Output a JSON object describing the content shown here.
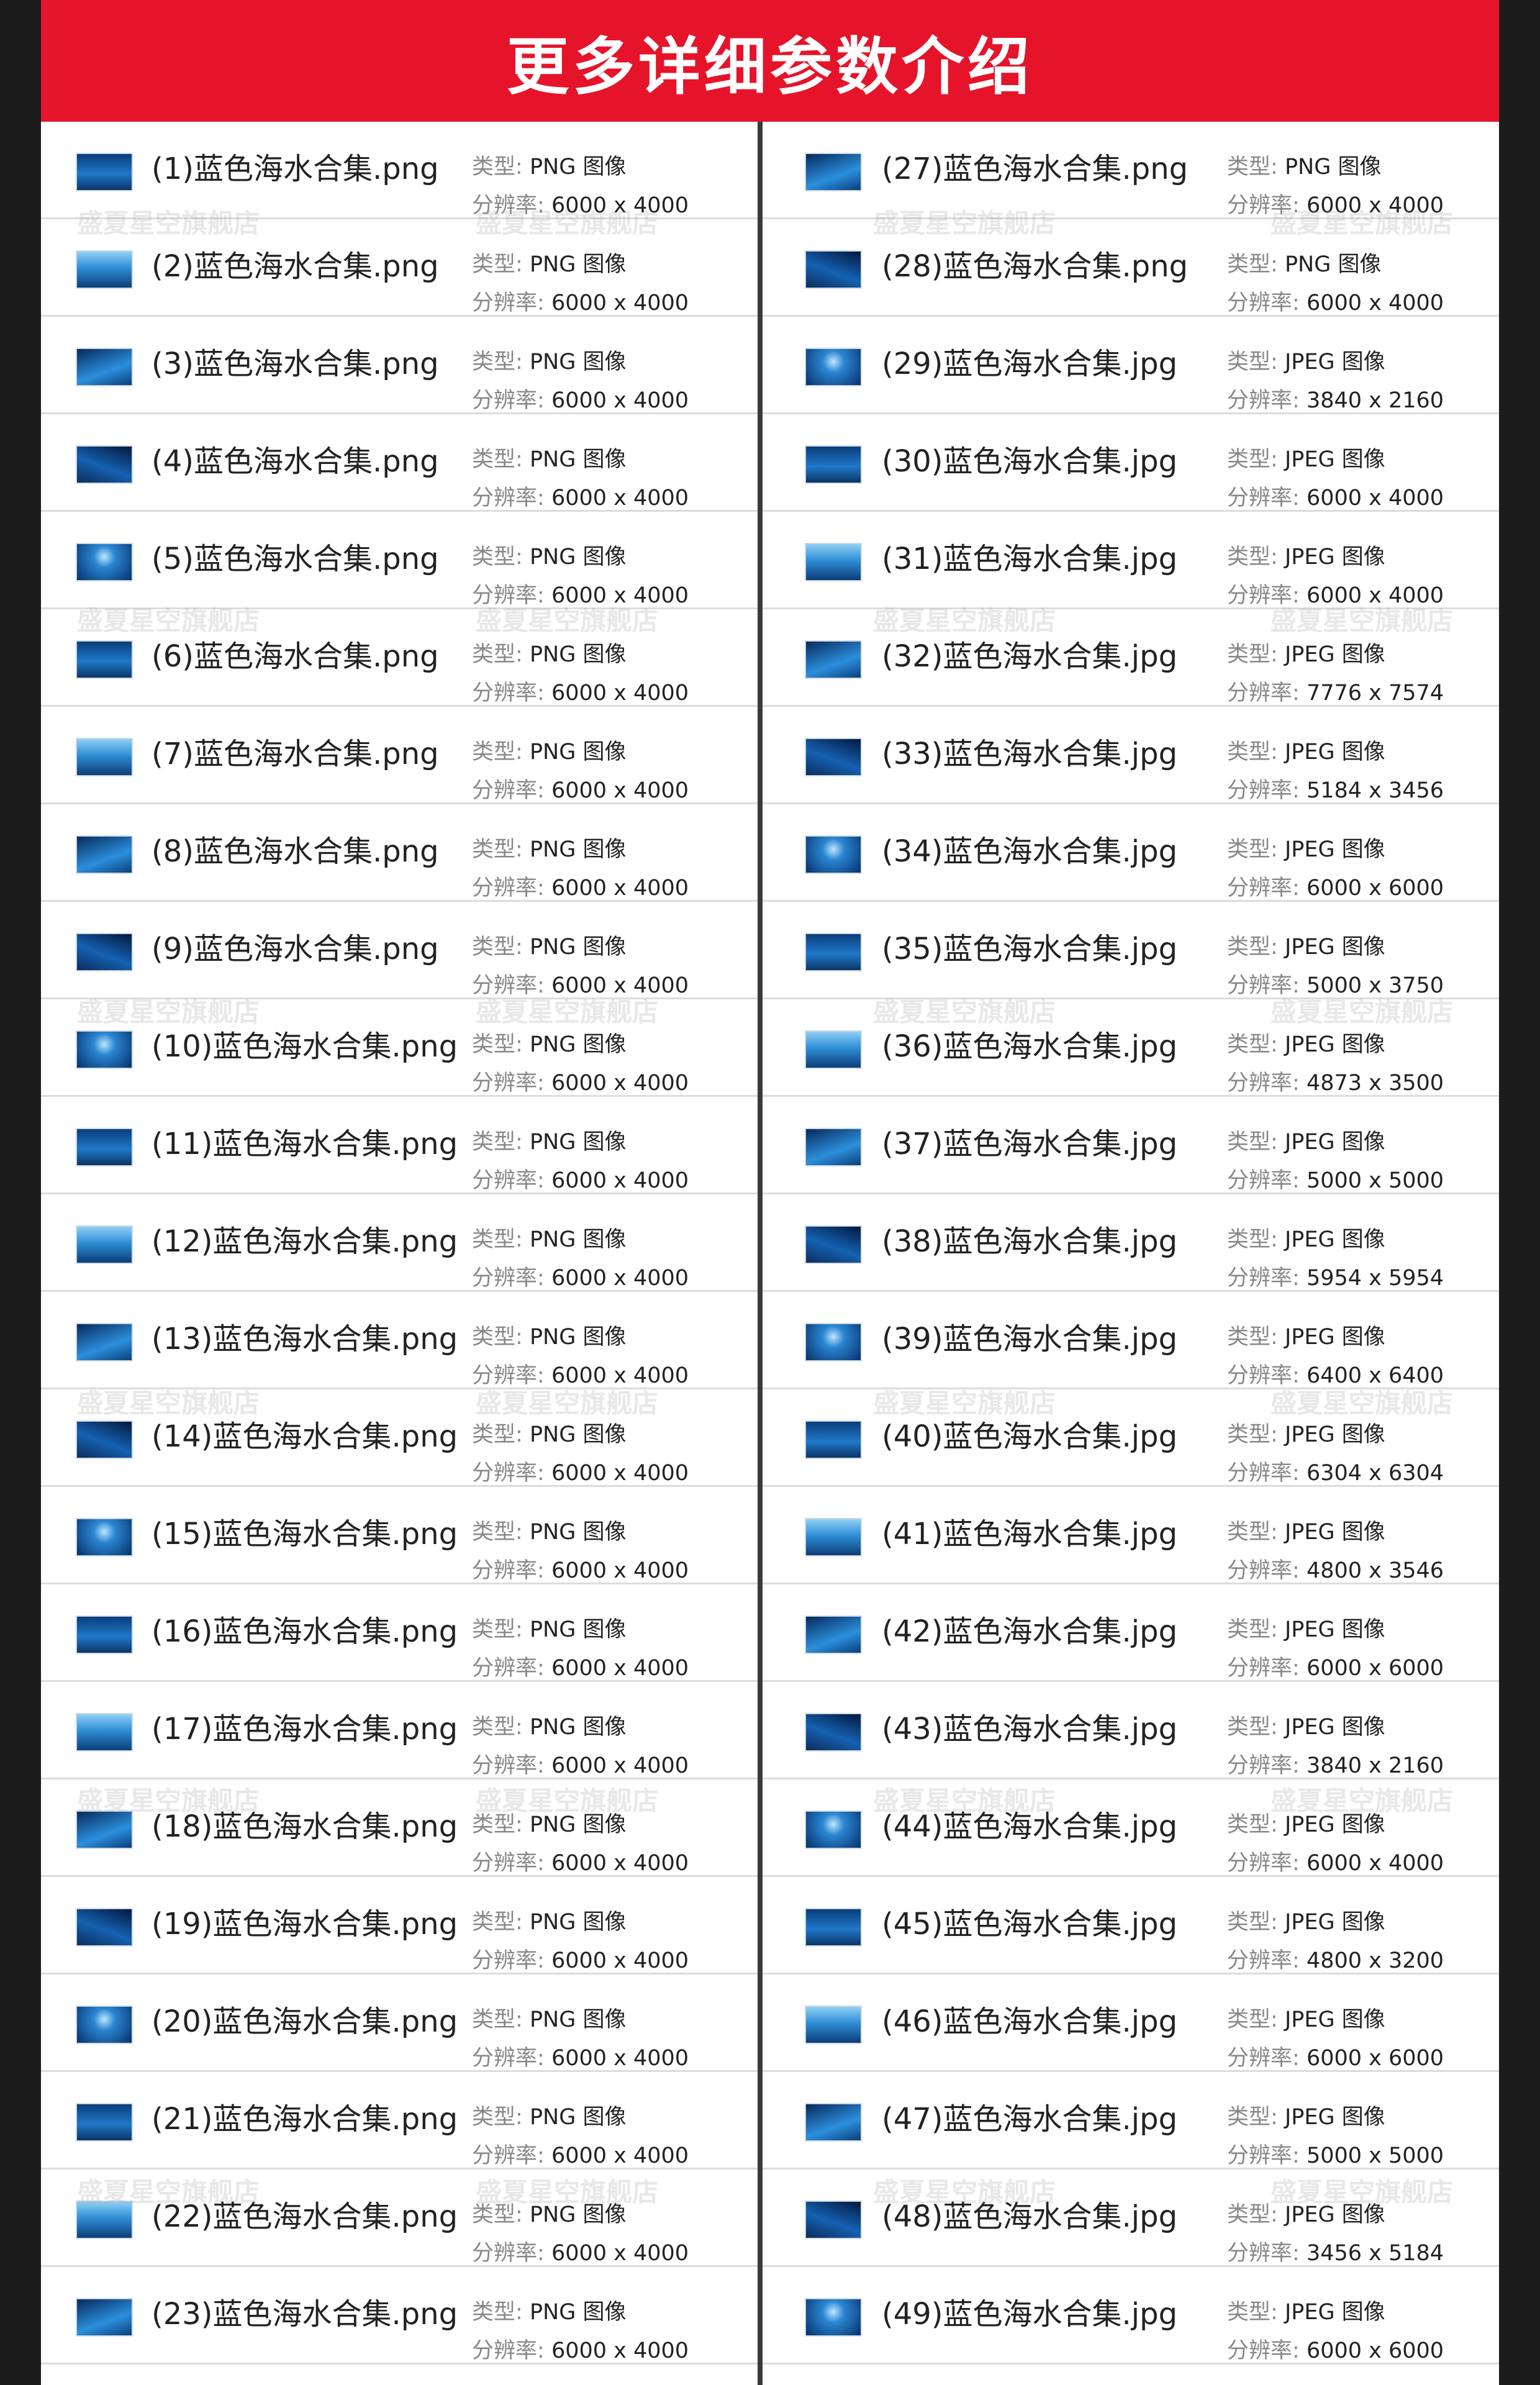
{
  "header": {
    "title": "更多详细参数介绍"
  },
  "labels": {
    "type": "类型:",
    "resolution": "分辨率:"
  },
  "watermark": "盛夏星空旗舰店",
  "left_items": [
    {
      "name": "(1)蓝色海水合集.png",
      "type": "PNG 图像",
      "res": "6000 x 4000"
    },
    {
      "name": "(2)蓝色海水合集.png",
      "type": "PNG 图像",
      "res": "6000 x 4000"
    },
    {
      "name": "(3)蓝色海水合集.png",
      "type": "PNG 图像",
      "res": "6000 x 4000"
    },
    {
      "name": "(4)蓝色海水合集.png",
      "type": "PNG 图像",
      "res": "6000 x 4000"
    },
    {
      "name": "(5)蓝色海水合集.png",
      "type": "PNG 图像",
      "res": "6000 x 4000"
    },
    {
      "name": "(6)蓝色海水合集.png",
      "type": "PNG 图像",
      "res": "6000 x 4000"
    },
    {
      "name": "(7)蓝色海水合集.png",
      "type": "PNG 图像",
      "res": "6000 x 4000"
    },
    {
      "name": "(8)蓝色海水合集.png",
      "type": "PNG 图像",
      "res": "6000 x 4000"
    },
    {
      "name": "(9)蓝色海水合集.png",
      "type": "PNG 图像",
      "res": "6000 x 4000"
    },
    {
      "name": "(10)蓝色海水合集.png",
      "type": "PNG 图像",
      "res": "6000 x 4000"
    },
    {
      "name": "(11)蓝色海水合集.png",
      "type": "PNG 图像",
      "res": "6000 x 4000"
    },
    {
      "name": "(12)蓝色海水合集.png",
      "type": "PNG 图像",
      "res": "6000 x 4000"
    },
    {
      "name": "(13)蓝色海水合集.png",
      "type": "PNG 图像",
      "res": "6000 x 4000"
    },
    {
      "name": "(14)蓝色海水合集.png",
      "type": "PNG 图像",
      "res": "6000 x 4000"
    },
    {
      "name": "(15)蓝色海水合集.png",
      "type": "PNG 图像",
      "res": "6000 x 4000"
    },
    {
      "name": "(16)蓝色海水合集.png",
      "type": "PNG 图像",
      "res": "6000 x 4000"
    },
    {
      "name": "(17)蓝色海水合集.png",
      "type": "PNG 图像",
      "res": "6000 x 4000"
    },
    {
      "name": "(18)蓝色海水合集.png",
      "type": "PNG 图像",
      "res": "6000 x 4000"
    },
    {
      "name": "(19)蓝色海水合集.png",
      "type": "PNG 图像",
      "res": "6000 x 4000"
    },
    {
      "name": "(20)蓝色海水合集.png",
      "type": "PNG 图像",
      "res": "6000 x 4000"
    },
    {
      "name": "(21)蓝色海水合集.png",
      "type": "PNG 图像",
      "res": "6000 x 4000"
    },
    {
      "name": "(22)蓝色海水合集.png",
      "type": "PNG 图像",
      "res": "6000 x 4000"
    },
    {
      "name": "(23)蓝色海水合集.png",
      "type": "PNG 图像",
      "res": "6000 x 4000"
    }
  ],
  "right_items": [
    {
      "name": "(27)蓝色海水合集.png",
      "type": "PNG 图像",
      "res": "6000 x 4000"
    },
    {
      "name": "(28)蓝色海水合集.png",
      "type": "PNG 图像",
      "res": "6000 x 4000"
    },
    {
      "name": "(29)蓝色海水合集.jpg",
      "type": "JPEG 图像",
      "res": "3840 x 2160"
    },
    {
      "name": "(30)蓝色海水合集.jpg",
      "type": "JPEG 图像",
      "res": "6000 x 4000"
    },
    {
      "name": "(31)蓝色海水合集.jpg",
      "type": "JPEG 图像",
      "res": "6000 x 4000"
    },
    {
      "name": "(32)蓝色海水合集.jpg",
      "type": "JPEG 图像",
      "res": "7776 x 7574"
    },
    {
      "name": "(33)蓝色海水合集.jpg",
      "type": "JPEG 图像",
      "res": "5184 x 3456"
    },
    {
      "name": "(34)蓝色海水合集.jpg",
      "type": "JPEG 图像",
      "res": "6000 x 6000"
    },
    {
      "name": "(35)蓝色海水合集.jpg",
      "type": "JPEG 图像",
      "res": "5000 x 3750"
    },
    {
      "name": "(36)蓝色海水合集.jpg",
      "type": "JPEG 图像",
      "res": "4873 x 3500"
    },
    {
      "name": "(37)蓝色海水合集.jpg",
      "type": "JPEG 图像",
      "res": "5000 x 5000"
    },
    {
      "name": "(38)蓝色海水合集.jpg",
      "type": "JPEG 图像",
      "res": "5954 x 5954"
    },
    {
      "name": "(39)蓝色海水合集.jpg",
      "type": "JPEG 图像",
      "res": "6400 x 6400"
    },
    {
      "name": "(40)蓝色海水合集.jpg",
      "type": "JPEG 图像",
      "res": "6304 x 6304"
    },
    {
      "name": "(41)蓝色海水合集.jpg",
      "type": "JPEG 图像",
      "res": "4800 x 3546"
    },
    {
      "name": "(42)蓝色海水合集.jpg",
      "type": "JPEG 图像",
      "res": "6000 x 6000"
    },
    {
      "name": "(43)蓝色海水合集.jpg",
      "type": "JPEG 图像",
      "res": "3840 x 2160"
    },
    {
      "name": "(44)蓝色海水合集.jpg",
      "type": "JPEG 图像",
      "res": "6000 x 4000"
    },
    {
      "name": "(45)蓝色海水合集.jpg",
      "type": "JPEG 图像",
      "res": "4800 x 3200"
    },
    {
      "name": "(46)蓝色海水合集.jpg",
      "type": "JPEG 图像",
      "res": "6000 x 6000"
    },
    {
      "name": "(47)蓝色海水合集.jpg",
      "type": "JPEG 图像",
      "res": "5000 x 5000"
    },
    {
      "name": "(48)蓝色海水合集.jpg",
      "type": "JPEG 图像",
      "res": "3456 x 5184"
    },
    {
      "name": "(49)蓝色海水合集.jpg",
      "type": "JPEG 图像",
      "res": "6000 x 6000"
    }
  ]
}
